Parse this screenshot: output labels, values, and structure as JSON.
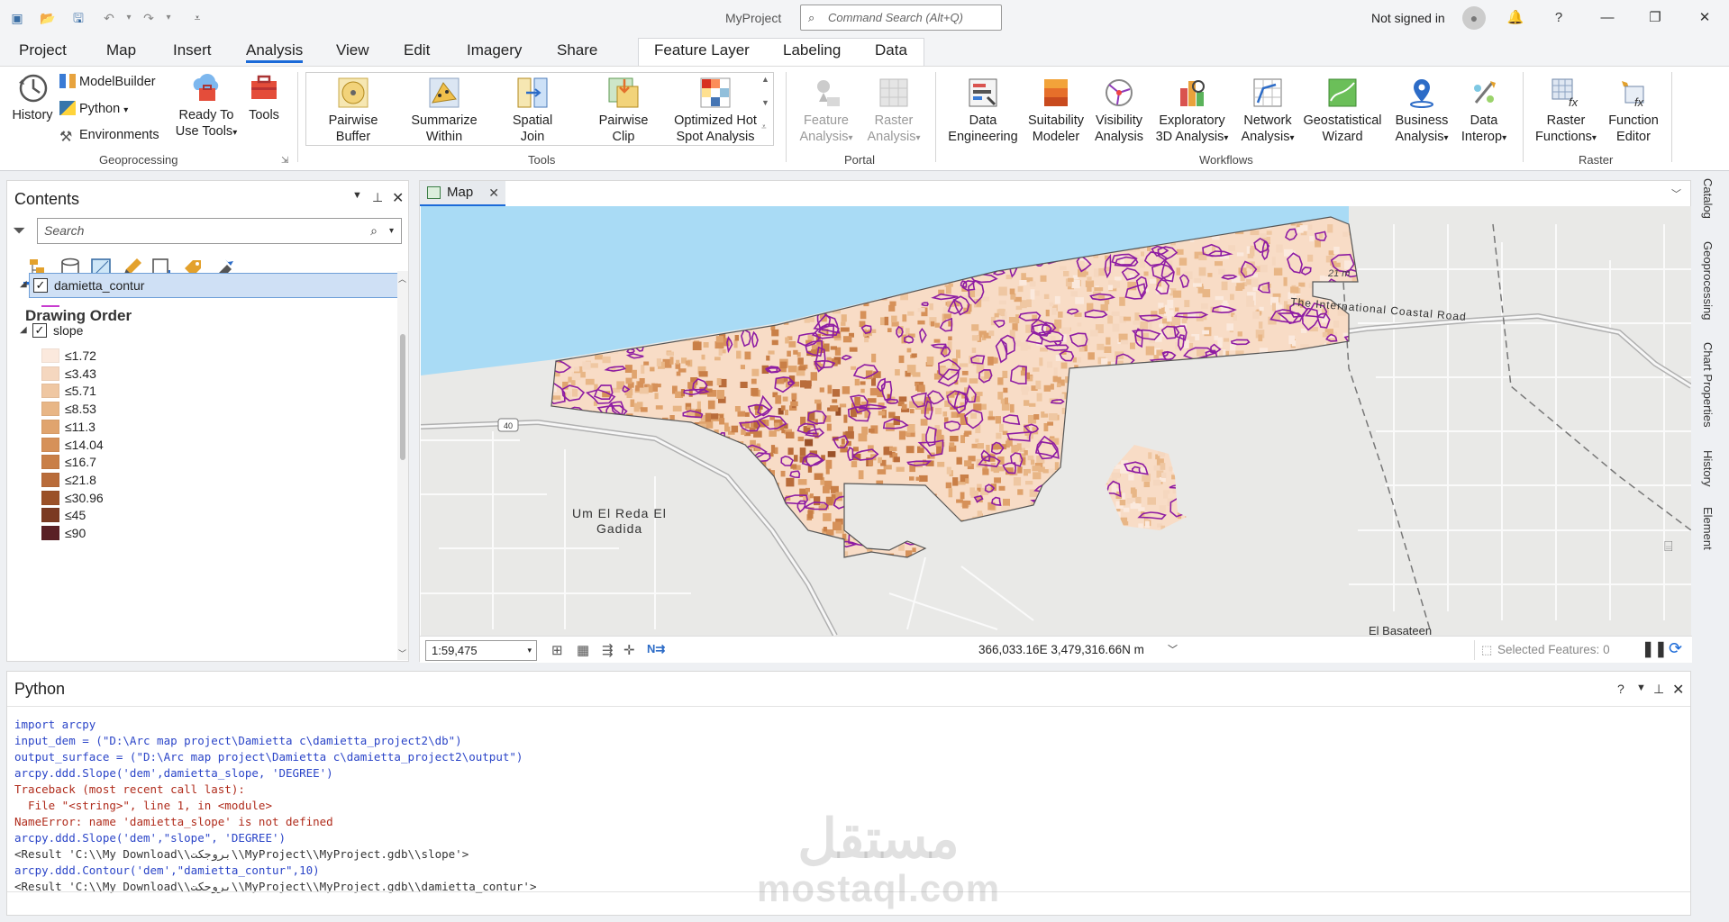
{
  "app": {
    "title": "MyProject",
    "command_search_placeholder": "Command Search (Alt+Q)",
    "signin": "Not signed in"
  },
  "menu_tabs": [
    "Project",
    "Map",
    "Insert",
    "Analysis",
    "View",
    "Edit",
    "Imagery",
    "Share"
  ],
  "context_tabs": [
    "Feature Layer",
    "Labeling",
    "Data"
  ],
  "ribbon": {
    "geoprocessing": {
      "history": "History",
      "modelbuilder": "ModelBuilder",
      "python": "Python",
      "environments": "Environments",
      "ready_to_use_1": "Ready To",
      "ready_to_use_2": "Use Tools",
      "tools": "Tools",
      "group": "Geoprocessing"
    },
    "tools": {
      "group": "Tools",
      "items": [
        [
          "Pairwise",
          "Buffer"
        ],
        [
          "Summarize",
          "Within"
        ],
        [
          "Spatial",
          "Join"
        ],
        [
          "Pairwise",
          "Clip"
        ],
        [
          "Optimized Hot",
          "Spot Analysis"
        ]
      ]
    },
    "portal": {
      "group": "Portal",
      "items": [
        [
          "Feature",
          "Analysis"
        ],
        [
          "Raster",
          "Analysis"
        ]
      ]
    },
    "workflows": {
      "group": "Workflows",
      "items": [
        [
          "Data",
          "Engineering"
        ],
        [
          "Suitability",
          "Modeler"
        ],
        [
          "Visibility",
          "Analysis"
        ],
        [
          "Exploratory",
          "3D Analysis"
        ],
        [
          "Network",
          "Analysis"
        ],
        [
          "Geostatistical",
          "Wizard"
        ],
        [
          "Business",
          "Analysis"
        ],
        [
          "Data",
          "Interop"
        ]
      ]
    },
    "raster": {
      "group": "Raster",
      "items": [
        [
          "Raster",
          "Functions"
        ],
        [
          "Function",
          "Editor"
        ]
      ]
    }
  },
  "contents": {
    "title": "Contents",
    "search_placeholder": "Search",
    "drawing_order": "Drawing Order",
    "layers": [
      {
        "name": "damietta_contur",
        "checked": true
      },
      {
        "name": "slope",
        "checked": true
      }
    ],
    "legend": [
      {
        "label": "≤1.72",
        "color": "#fbe9dd"
      },
      {
        "label": "≤3.43",
        "color": "#f5d7bf"
      },
      {
        "label": "≤5.71",
        "color": "#efc7a2"
      },
      {
        "label": "≤8.53",
        "color": "#e8b686"
      },
      {
        "label": "≤11.3",
        "color": "#e0a46e"
      },
      {
        "label": "≤14.04",
        "color": "#d69159"
      },
      {
        "label": "≤16.7",
        "color": "#c97f47"
      },
      {
        "label": "≤21.8",
        "color": "#b96c3a"
      },
      {
        "label": "≤30.96",
        "color": "#9b5128"
      },
      {
        "label": "≤45",
        "color": "#7b3a22"
      },
      {
        "label": "≤90",
        "color": "#5a2025"
      }
    ]
  },
  "map": {
    "tab": "Map",
    "scale": "1:59,475",
    "coordinates": "366,033.16E 3,479,316.66N m",
    "selected_features": "Selected Features: 0",
    "labels": {
      "road_name": "The International Coastal Road",
      "town": "Um El Reda El",
      "town2": "Gadida",
      "elevation": "21 m",
      "route": "40",
      "bottom_town": "El Basateen"
    }
  },
  "side_tabs": [
    "Catalog",
    "Geoprocessing",
    "Chart Properties",
    "History",
    "Element"
  ],
  "python": {
    "title": "Python",
    "lines": [
      {
        "t": "import arcpy",
        "k": "code"
      },
      {
        "t": "input_dem = (\"D:\\Arc map project\\Damietta c\\damietta_project2\\db\")",
        "k": "code"
      },
      {
        "t": "output_surface = (\"D:\\Arc map project\\Damietta c\\damietta_project2\\output\")",
        "k": "code"
      },
      {
        "t": "arcpy.ddd.Slope('dem',damietta_slope, 'DEGREE')",
        "k": "code"
      },
      {
        "t": "Traceback (most recent call last):",
        "k": "err"
      },
      {
        "t": "  File \"<string>\", line 1, in <module>",
        "k": "err"
      },
      {
        "t": "NameError: name 'damietta_slope' is not defined",
        "k": "err"
      },
      {
        "t": "arcpy.ddd.Slope('dem',\"slope\", 'DEGREE')",
        "k": "code"
      },
      {
        "t": "<Result 'C:\\\\My Download\\\\بروجكت\\\\MyProject\\\\MyProject.gdb\\\\slope'>",
        "k": "res"
      },
      {
        "t": "arcpy.ddd.Contour('dem',\"damietta_contur\",10)",
        "k": "code"
      },
      {
        "t": "<Result 'C:\\\\My Download\\\\بروجكت\\\\MyProject\\\\MyProject.gdb\\\\damietta_contur'>",
        "k": "res"
      }
    ]
  },
  "watermark": {
    "arabic": "مستقل",
    "latin": "mostaql.com"
  },
  "colors": {
    "accent": "#1b6ad8",
    "water": "#a9dbf5",
    "land": "#e9e9e7",
    "contour": "#8e1ca3",
    "selected_row": "#cfe0f5"
  }
}
